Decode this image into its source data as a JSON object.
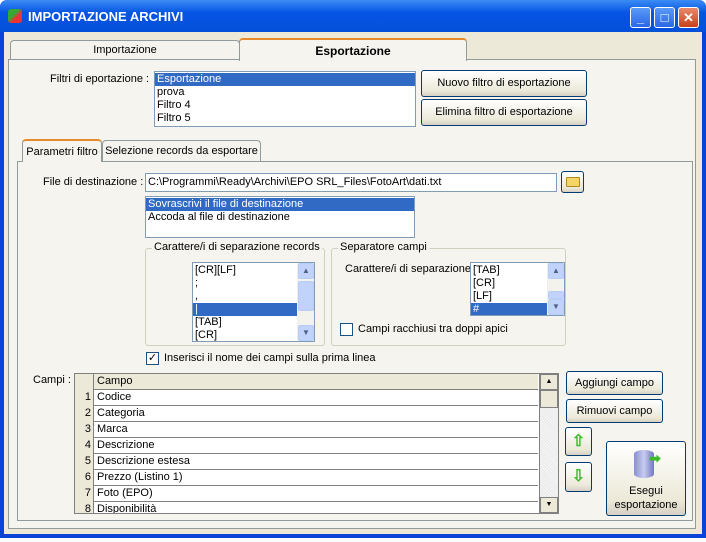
{
  "window": {
    "title": "IMPORTAZIONE ARCHIVI",
    "minimize": "_",
    "maximize": "□",
    "close": "✕"
  },
  "main_tabs": [
    {
      "label": "Importazione"
    },
    {
      "label": "Esportazione",
      "selected": true
    }
  ],
  "filters": {
    "label": "Filtri di eportazione :",
    "items": [
      "Esportazione",
      "prova",
      "Filtro 4",
      "Filtro 5"
    ],
    "selected": 0,
    "new_button": "Nuovo filtro di esportazione",
    "delete_button": "Elimina filtro di esportazione"
  },
  "sub_tabs": [
    {
      "label": "Parametri filtro",
      "selected": true
    },
    {
      "label": "Selezione records da esportare"
    }
  ],
  "destination": {
    "label": "File di destinazione :",
    "value": "C:\\Programmi\\Ready\\Archivi\\EPO SRL_Files\\FotoArt\\dati.txt",
    "browse_icon": "folder-icon"
  },
  "write_mode": {
    "items": [
      "Sovrascrivi il file di destinazione",
      "Accoda al file di destinazione"
    ],
    "selected": 0
  },
  "record_sep": {
    "title": "Carattere/i di separazione records",
    "items": [
      "[CR][LF]",
      ";",
      ",",
      "|",
      "[TAB]",
      "[CR]"
    ],
    "selected": 3
  },
  "field_sep": {
    "title": "Separatore campi",
    "label": "Carattere/i di separazione",
    "items": [
      "[TAB]",
      "[CR]",
      "[LF]",
      "#"
    ],
    "selected": 3,
    "quotes_label": "Campi racchiusi tra doppi apici",
    "quotes_checked": false
  },
  "header_line": {
    "label": "Inserisci il nome dei campi sulla prima linea",
    "checked": true
  },
  "fields": {
    "label": "Campi :",
    "column": "Campo",
    "rows": [
      {
        "n": "1",
        "name": "Codice"
      },
      {
        "n": "2",
        "name": "Categoria"
      },
      {
        "n": "3",
        "name": "Marca"
      },
      {
        "n": "4",
        "name": "Descrizione"
      },
      {
        "n": "5",
        "name": "Descrizione estesa"
      },
      {
        "n": "6",
        "name": "Prezzo (Listino 1)"
      },
      {
        "n": "7",
        "name": "Foto (EPO)"
      },
      {
        "n": "8",
        "name": "Disponibilità"
      }
    ],
    "add_button": "Aggiungi campo",
    "remove_button": "Rimuovi campo",
    "up_icon": "arrow-up-icon",
    "down_icon": "arrow-down-icon"
  },
  "run": {
    "label1": "Esegui",
    "label2": "esportazione",
    "icon": "database-export-icon"
  }
}
